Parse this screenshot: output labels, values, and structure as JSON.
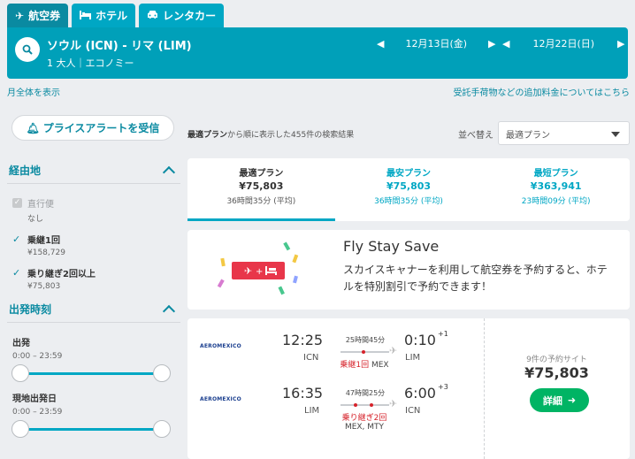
{
  "tabs": [
    {
      "label": "航空券",
      "icon": "plane-icon"
    },
    {
      "label": "ホテル",
      "icon": "bed-icon"
    },
    {
      "label": "レンタカー",
      "icon": "car-icon"
    }
  ],
  "search": {
    "route": "ソウル (ICN) - リマ (LIM)",
    "passengers": "1 大人｜エコノミー",
    "depart_date": "12月13日(金)",
    "return_date": "12月22日(日)"
  },
  "links": {
    "month_view": "月全体を表示",
    "fees": "受託手荷物などの追加料金についてはこちら"
  },
  "sidebar": {
    "alert_button": "プライスアラートを受信",
    "stops_section": {
      "title": "経由地",
      "options": [
        {
          "label": "直行便",
          "price": "なし",
          "checked": true,
          "disabled": true
        },
        {
          "label": "乗継1回",
          "price": "¥158,729",
          "checked": true,
          "disabled": false
        },
        {
          "label": "乗り継ぎ2回以上",
          "price": "¥75,803",
          "checked": true,
          "disabled": false
        }
      ]
    },
    "time_section": {
      "title": "出発時刻",
      "depart_label": "出発",
      "depart_range": "0:00 – 23:59",
      "local_label": "現地出発日",
      "local_range": "0:00 – 23:59"
    }
  },
  "results": {
    "summary_bold": "最適プラン",
    "summary_rest": "から順に表示した455件の検索結果",
    "sort_label": "並べ替え",
    "sort_value": "最適プラン"
  },
  "plan_cards": [
    {
      "title": "最適プラン",
      "price": "¥75,803",
      "duration": "36時間35分 (平均)",
      "selected": true
    },
    {
      "title": "最安プラン",
      "price": "¥75,803",
      "duration": "36時間35分 (平均)",
      "selected": false
    },
    {
      "title": "最短プラン",
      "price": "¥363,941",
      "duration": "23時間09分 (平均)",
      "selected": false
    }
  ],
  "promo": {
    "title": "Fly Stay Save",
    "text": "スカイスキャナーを利用して航空券を予約すると、ホテルを特別割引で予約できます！"
  },
  "flight": {
    "airline": "AEROMEXICO",
    "legs": [
      {
        "dep_time": "12:25",
        "dep_code": "ICN",
        "duration": "25時間45分",
        "stops_red": "乗継1回",
        "stops_via": "MEX",
        "arr_time": "0:10",
        "arr_offset": "+1",
        "arr_code": "LIM"
      },
      {
        "dep_time": "16:35",
        "dep_code": "LIM",
        "duration": "47時間25分",
        "stops_red": "乗り継ぎ2回",
        "stops_via": "MEX, MTY",
        "arr_time": "6:00",
        "arr_offset": "+3",
        "arr_code": "ICN"
      }
    ],
    "sites": "9件の予約サイト",
    "price": "¥75,803",
    "detail_label": "詳細"
  },
  "colors": {
    "primary": "#00a0b9",
    "accent": "#00a7c4",
    "cta": "#00b464",
    "warn": "#d6222a"
  }
}
